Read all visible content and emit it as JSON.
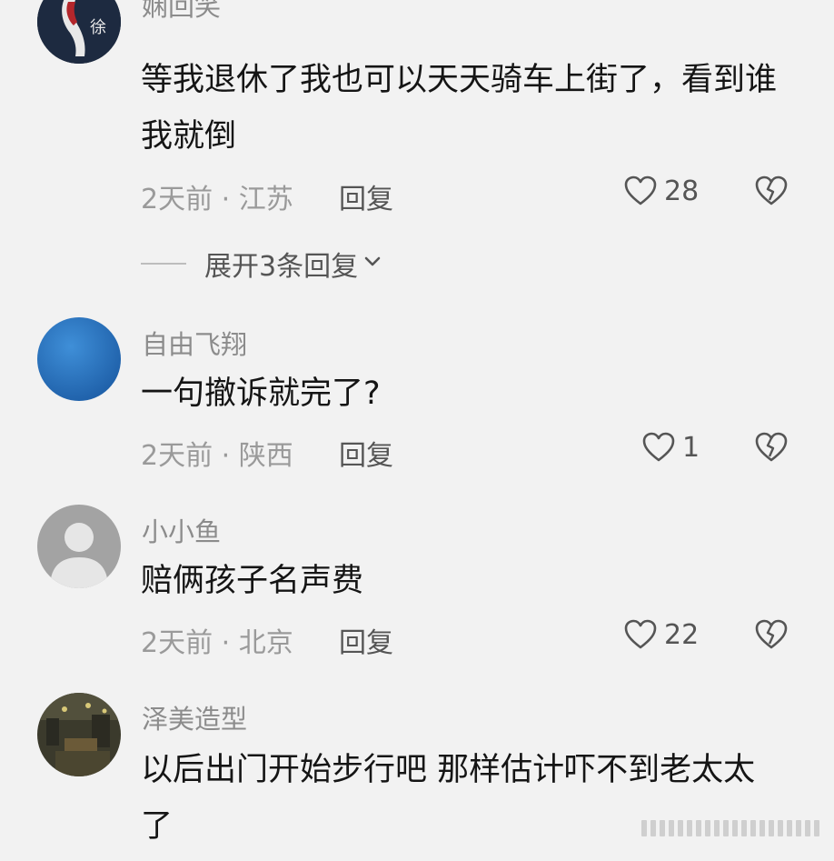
{
  "comments": [
    {
      "username": "娴回笑",
      "text": "等我退休了我也可以天天骑车上街了，看到谁我就倒",
      "time": "2天前",
      "location": "江苏",
      "reply_label": "回复",
      "likes": "28",
      "avatar_text": "徐",
      "expand_label": "展开3条回复"
    },
    {
      "username": "自由飞翔",
      "text": "一句撤诉就完了?",
      "time": "2天前",
      "location": "陕西",
      "reply_label": "回复",
      "likes": "1"
    },
    {
      "username": "小小鱼",
      "text": "赔俩孩子名声费",
      "time": "2天前",
      "location": "北京",
      "reply_label": "回复",
      "likes": "22"
    },
    {
      "username": "泽美造型",
      "text": "以后出门开始步行吧 那样估计吓不到老太太了"
    }
  ],
  "meta_separator": " · ",
  "colors": {
    "background": "#f2f2f2",
    "text_primary": "#151515",
    "text_secondary": "#8c8c8c",
    "icon": "#555555"
  },
  "icons": [
    "heart-outline-icon",
    "broken-heart-icon",
    "chevron-down-icon"
  ]
}
